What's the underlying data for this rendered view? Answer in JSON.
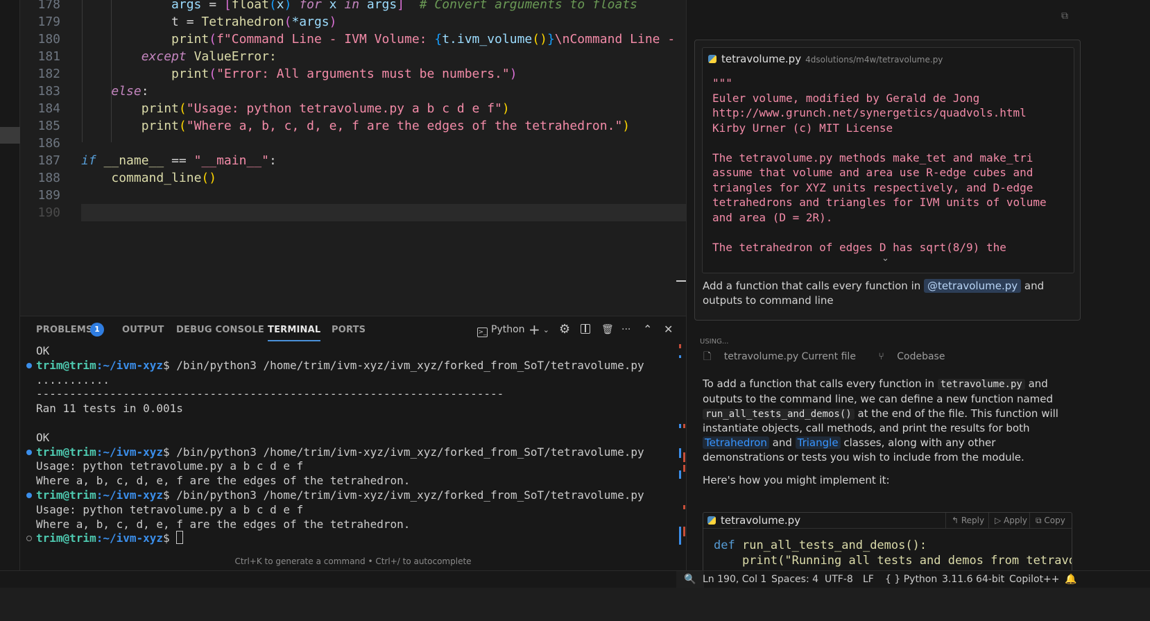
{
  "editor": {
    "lines": [
      {
        "num": "178",
        "segments": [
          {
            "t": "            ",
            "c": "op"
          },
          {
            "t": "args",
            "c": "var"
          },
          {
            "t": " = ",
            "c": "op"
          },
          {
            "t": "[",
            "c": "br2"
          },
          {
            "t": "float",
            "c": "fn"
          },
          {
            "t": "(",
            "c": "br3"
          },
          {
            "t": "x",
            "c": "var"
          },
          {
            "t": ") ",
            "c": "br3"
          },
          {
            "t": "for",
            "c": "kw"
          },
          {
            "t": " x ",
            "c": "var"
          },
          {
            "t": "in",
            "c": "kw"
          },
          {
            "t": " args",
            "c": "var"
          },
          {
            "t": "]",
            "c": "br2"
          },
          {
            "t": "  # Convert arguments to floats",
            "c": "cmt"
          }
        ]
      },
      {
        "num": "179",
        "segments": [
          {
            "t": "            t = ",
            "c": "op"
          },
          {
            "t": "Tetrahedron",
            "c": "fn"
          },
          {
            "t": "(",
            "c": "br2"
          },
          {
            "t": "*args",
            "c": "var"
          },
          {
            "t": ")",
            "c": "br2"
          }
        ]
      },
      {
        "num": "180",
        "segments": [
          {
            "t": "            ",
            "c": "op"
          },
          {
            "t": "print",
            "c": "fn"
          },
          {
            "t": "(",
            "c": "br2"
          },
          {
            "t": "f\"Command Line - IVM Volume: ",
            "c": "pink"
          },
          {
            "t": "{",
            "c": "br3"
          },
          {
            "t": "t.ivm_volume",
            "c": "var"
          },
          {
            "t": "()",
            "c": "br1"
          },
          {
            "t": "}",
            "c": "br3"
          },
          {
            "t": "\\nCommand Line - ",
            "c": "pink"
          }
        ]
      },
      {
        "num": "181",
        "segments": [
          {
            "t": "        ",
            "c": "op"
          },
          {
            "t": "except",
            "c": "kw"
          },
          {
            "t": " ValueError:",
            "c": "fn"
          }
        ]
      },
      {
        "num": "182",
        "segments": [
          {
            "t": "            ",
            "c": "op"
          },
          {
            "t": "print",
            "c": "fn"
          },
          {
            "t": "(",
            "c": "br2"
          },
          {
            "t": "\"Error: All arguments must be numbers.\"",
            "c": "pink"
          },
          {
            "t": ")",
            "c": "br2"
          }
        ]
      },
      {
        "num": "183",
        "segments": [
          {
            "t": "    ",
            "c": "op"
          },
          {
            "t": "else",
            "c": "kw"
          },
          {
            "t": ":",
            "c": "op"
          }
        ]
      },
      {
        "num": "184",
        "segments": [
          {
            "t": "        ",
            "c": "op"
          },
          {
            "t": "print",
            "c": "fn"
          },
          {
            "t": "(",
            "c": "br1"
          },
          {
            "t": "\"Usage: python tetravolume.py a b c d e f\"",
            "c": "pink"
          },
          {
            "t": ")",
            "c": "br1"
          }
        ]
      },
      {
        "num": "185",
        "segments": [
          {
            "t": "        ",
            "c": "op"
          },
          {
            "t": "print",
            "c": "fn"
          },
          {
            "t": "(",
            "c": "br1"
          },
          {
            "t": "\"Where a, b, c, d, e, f are the edges of the tetrahedron.\"",
            "c": "pink"
          },
          {
            "t": ")",
            "c": "br1"
          }
        ]
      },
      {
        "num": "186",
        "segments": []
      },
      {
        "num": "187",
        "segments": [
          {
            "t": "if",
            "c": "kw2"
          },
          {
            "t": " __name__ ",
            "c": "fn"
          },
          {
            "t": "== ",
            "c": "op"
          },
          {
            "t": "\"__main__\"",
            "c": "pink"
          },
          {
            "t": ":",
            "c": "op"
          }
        ]
      },
      {
        "num": "188",
        "segments": [
          {
            "t": "    ",
            "c": "op"
          },
          {
            "t": "command_line",
            "c": "fn"
          },
          {
            "t": "()",
            "c": "br1"
          }
        ]
      },
      {
        "num": "189",
        "segments": []
      },
      {
        "num": "190",
        "segments": [],
        "current": true
      }
    ]
  },
  "panel": {
    "tabs": [
      {
        "label": "PROBLEMS",
        "active": false
      },
      {
        "label": "OUTPUT",
        "active": false
      },
      {
        "label": "DEBUG CONSOLE",
        "active": false
      },
      {
        "label": "TERMINAL",
        "active": true
      },
      {
        "label": "PORTS",
        "active": false
      }
    ],
    "problems_count": "1",
    "shell_label": "Python",
    "hint": "Ctrl+K to generate a command • Ctrl+/ to autocomplete"
  },
  "terminal": {
    "prompt_user": "trim@trim",
    "prompt_path": ":~/ivm-xyz",
    "lines": [
      {
        "kind": "text",
        "text": "OK"
      },
      {
        "kind": "cmd",
        "dot": "#3b8eea",
        "text": "$ /bin/python3 /home/trim/ivm-xyz/ivm_xyz/forked_from_SoT/tetravolume.py"
      },
      {
        "kind": "text",
        "text": "..........."
      },
      {
        "kind": "text",
        "text": "----------------------------------------------------------------------"
      },
      {
        "kind": "text",
        "text": "Ran 11 tests in 0.001s"
      },
      {
        "kind": "text",
        "text": ""
      },
      {
        "kind": "text",
        "text": "OK"
      },
      {
        "kind": "cmd",
        "dot": "#3b8eea",
        "text": "$ /bin/python3 /home/trim/ivm-xyz/ivm_xyz/forked_from_SoT/tetravolume.py"
      },
      {
        "kind": "text",
        "text": "Usage: python tetravolume.py a b c d e f"
      },
      {
        "kind": "text",
        "text": "Where a, b, c, d, e, f are the edges of the tetrahedron."
      },
      {
        "kind": "cmd",
        "dot": "#3b8eea",
        "text": "$ /bin/python3 /home/trim/ivm-xyz/ivm_xyz/forked_from_SoT/tetravolume.py"
      },
      {
        "kind": "text",
        "text": "Usage: python tetravolume.py a b c d e f"
      },
      {
        "kind": "text",
        "text": "Where a, b, c, d, e, f are the edges of the tetrahedron."
      },
      {
        "kind": "prompt",
        "dot": "hollow",
        "text": "$ "
      }
    ]
  },
  "chat": {
    "file_preview": {
      "filename": "tetravolume.py",
      "path": "4dsolutions/m4w/tetravolume.py",
      "lines": [
        "\"\"\"",
        "Euler volume, modified by Gerald de Jong",
        "http://www.grunch.net/synergetics/quadvols.html",
        "Kirby Urner (c) MIT License",
        "",
        "The tetravolume.py methods make_tet and make_tri",
        "assume that volume and area use R-edge cubes and",
        "triangles for XYZ units respectively, and D-edge",
        "tetrahedrons and triangles for IVM units of volume",
        "and area (D = 2R).",
        "",
        "The tetrahedron of edges D has sqrt(8/9) the"
      ]
    },
    "user_message": {
      "before": "Add a function that calls every function in ",
      "mention": "@tetravolume.py",
      "after": " and outputs to command line"
    },
    "using_label": "USING...",
    "context": [
      "tetravolume.py Current file",
      "Codebase"
    ],
    "answer": {
      "p1": "To add a function that calls every function in ",
      "code1": "tetravolume.py",
      "p2": " and outputs to the command line, we can define a new function named ",
      "code2": "run_all_tests_and_demos()",
      "p3": " at the end of the file. This function will instantiate objects, call methods, and print the results for both ",
      "link1": "Tetrahedron",
      "p4": " and ",
      "link2": "Triangle",
      "p5": " classes, along with any other demonstrations or tests you wish to include from the module.",
      "p6": "Here's how you might implement it:"
    },
    "code_block": {
      "filename": "tetravolume.py",
      "actions": [
        "Reply",
        "Apply",
        "Copy"
      ],
      "line1": "def run_all_tests_and_demos():",
      "line2": "    print(\"Running all tests and demos from tetravolu"
    }
  },
  "statusbar": {
    "position": "Ln 190, Col 1",
    "spaces": "Spaces: 4",
    "encoding": "UTF-8",
    "eol": "LF",
    "language": "Python",
    "interpreter": "3.11.6 64-bit",
    "copilot": "Copilot++"
  },
  "colors": {
    "accent": "#2f7de1",
    "string": "#f38ba8",
    "prompt_user": "#4ec9b0",
    "prompt_path": "#3b8eea"
  }
}
